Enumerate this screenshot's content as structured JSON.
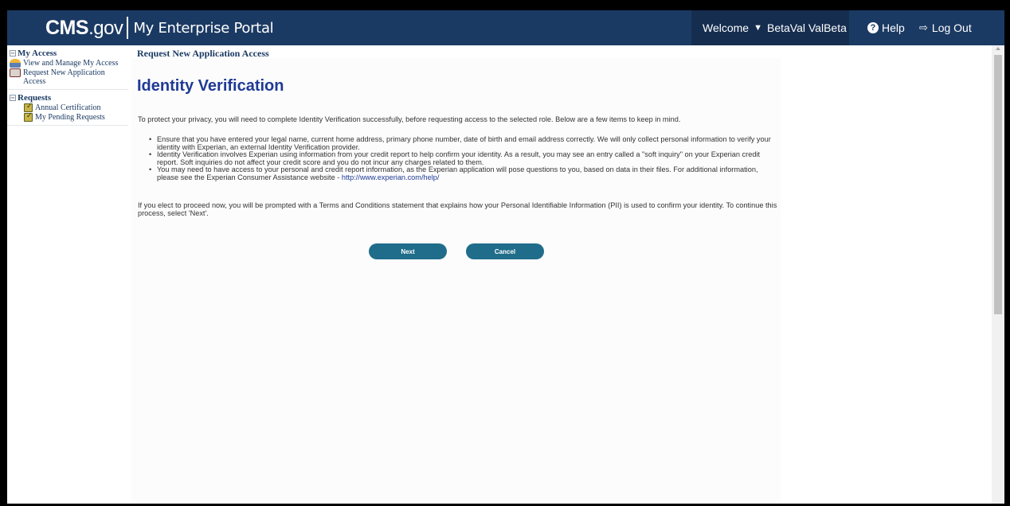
{
  "header": {
    "brand_cms": "CMS",
    "brand_gov": ".gov",
    "portal": "My Enterprise Portal",
    "welcome": "Welcome",
    "user": "BetaVal ValBeta",
    "help": "Help",
    "logout": "Log Out",
    "colors": {
      "bar": "#1b3a63",
      "welcome_bg": "#152d4f"
    }
  },
  "sidebar": {
    "sections": [
      {
        "title": "My Access",
        "items": [
          {
            "label": "View and Manage My Access",
            "icon": "people-icon"
          },
          {
            "label": "Request New Application Access",
            "icon": "book-icon"
          }
        ]
      },
      {
        "title": "Requests",
        "items": [
          {
            "label": "Annual Certification",
            "icon": "checklist-icon"
          },
          {
            "label": "My Pending Requests",
            "icon": "checklist-icon"
          }
        ]
      }
    ]
  },
  "main": {
    "breadcrumb": "Request New Application Access",
    "title": "Identity Verification",
    "intro": "To protect your privacy, you will need to complete Identity Verification successfully, before requesting access to the selected role. Below are a few items to keep in mind.",
    "bullets": [
      "Ensure that you have entered your legal name, current home address, primary phone number, date of birth and email address correctly. We will only collect personal information to verify your identity with Experian, an external Identity Verification provider.",
      "Identity Verification involves Experian using information from your credit report to help confirm your identity. As a result, you may see an entry called a \"soft inquiry\" on your Experian credit report. Soft inquiries do not affect your credit score and you do not incur any charges related to them.",
      "You may need to have access to your personal and credit report information, as the Experian application will pose questions to you, based on data in their files. For additional information, please see the Experian Consumer Assistance website - "
    ],
    "experian_link": "http://www.experian.com/help/",
    "outro": "If you elect to proceed now, you will be prompted with a Terms and Conditions statement that explains how your Personal Identifiable Information (PII) is used to confirm your identity. To continue this process, select 'Next'.",
    "next_button": "Next",
    "cancel_button": "Cancel"
  }
}
